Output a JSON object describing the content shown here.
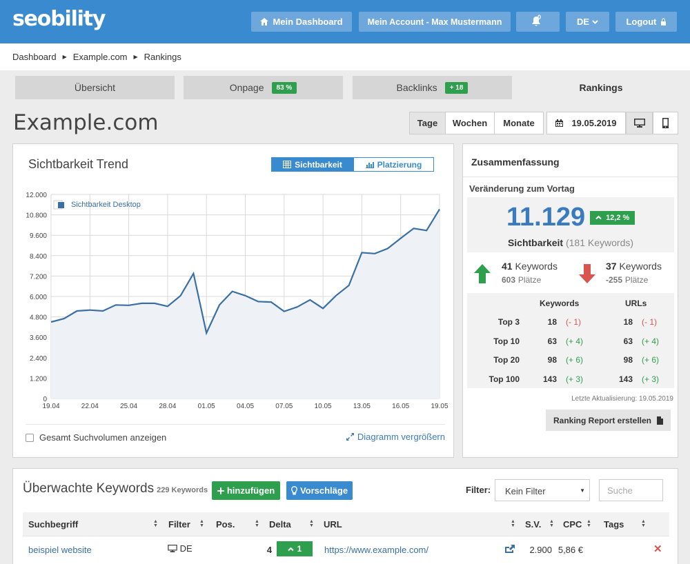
{
  "brand": {
    "logo": "seobility",
    "primary_color": "#3a8ad0"
  },
  "header": {
    "dashboard_label": "Mein Dashboard",
    "account_label": "Mein Account - Max Mustermann",
    "notifications_count": "0",
    "language_label": "DE",
    "logout_label": "Logout"
  },
  "breadcrumb": [
    "Dashboard",
    "Example.com",
    "Rankings"
  ],
  "tabs": [
    {
      "label": "Übersicht"
    },
    {
      "label": "Onpage",
      "badge": "83 %"
    },
    {
      "label": "Backlinks",
      "badge": "+ 18"
    },
    {
      "label": "Rankings",
      "active": true
    }
  ],
  "page": {
    "title": "Example.com"
  },
  "period": {
    "options": [
      "Tage",
      "Wochen",
      "Monate"
    ],
    "selected": "Tage",
    "date": "19.05.2019"
  },
  "chart_card": {
    "title": "Sichtbarkeit Trend",
    "toggle_visibility": "Sichtbarkeit",
    "toggle_ranking": "Platzierung",
    "checkbox_label": "Gesamt Suchvolumen anzeigen",
    "enlarge_label": "Diagramm vergrößern"
  },
  "chart_data": {
    "type": "area",
    "legend": "Sichtbarkeit Desktop",
    "legend_position": "top-left",
    "grid": true,
    "ylim": [
      0,
      12000
    ],
    "y_ticks": [
      "0",
      "1.200",
      "2.400",
      "3.600",
      "4.800",
      "6.000",
      "7.200",
      "8.400",
      "9.600",
      "10.800",
      "12.000"
    ],
    "x_ticks": [
      "19.04",
      "22.04",
      "25.04",
      "28.04",
      "01.05",
      "04.05",
      "07.05",
      "10.05",
      "13.05",
      "16.05",
      "19.05"
    ],
    "series": [
      {
        "name": "Sichtbarkeit Desktop",
        "values": [
          4500,
          4700,
          5150,
          5200,
          5150,
          5500,
          5480,
          5600,
          5600,
          5420,
          6050,
          7350,
          3850,
          5500,
          6300,
          6050,
          5700,
          5670,
          5120,
          5380,
          5800,
          5300,
          6050,
          6650,
          8580,
          8520,
          8820,
          9420,
          10000,
          9880,
          11129
        ]
      }
    ]
  },
  "summary": {
    "title": "Zusammenfassung",
    "subtitle": "Veränderung zum Vortag",
    "visibility_value": "11.129",
    "visibility_change": "12,2 %",
    "visibility_label": "Sichtbarkeit",
    "visibility_keywords": "(181 Keywords)",
    "up_count": "41",
    "up_label": "Keywords",
    "up_places": "603",
    "up_places_label": "Plätze",
    "down_count": "37",
    "down_label": "Keywords",
    "down_places": "-255",
    "down_places_label": "Plätze",
    "table_headers": [
      "Keywords",
      "URLs"
    ],
    "rows": [
      {
        "label": "Top 3",
        "kw": "18",
        "kw_delta": "(- 1)",
        "url": "18",
        "url_delta": "(- 1)"
      },
      {
        "label": "Top 10",
        "kw": "63",
        "kw_delta": "(+ 4)",
        "url": "63",
        "url_delta": "(+ 4)"
      },
      {
        "label": "Top 20",
        "kw": "98",
        "kw_delta": "(+ 6)",
        "url": "98",
        "url_delta": "(+ 6)"
      },
      {
        "label": "Top 100",
        "kw": "143",
        "kw_delta": "(+ 3)",
        "url": "143",
        "url_delta": "(+ 3)"
      }
    ],
    "last_update": "Letzte Aktualisierung: 19.05.2019",
    "report_button": "Ranking Report erstellen"
  },
  "keywords": {
    "title": "Überwachte Keywords",
    "count": "229 Keywords",
    "add_label": "hinzufügen",
    "suggest_label": "Vorschläge",
    "filter_label": "Filter:",
    "filter_selected": "Kein Filter",
    "search_placeholder": "Suche",
    "columns": [
      "Suchbegriff",
      "Filter",
      "Pos.",
      "Delta",
      "URL",
      "S.V.",
      "CPC",
      "Tags"
    ],
    "rows": [
      {
        "term": "beispiel website",
        "filter": "DE",
        "pos": "4",
        "delta": "1",
        "url": "https://www.example.com/",
        "sv": "2.900",
        "cpc": "5,86 €"
      }
    ]
  }
}
